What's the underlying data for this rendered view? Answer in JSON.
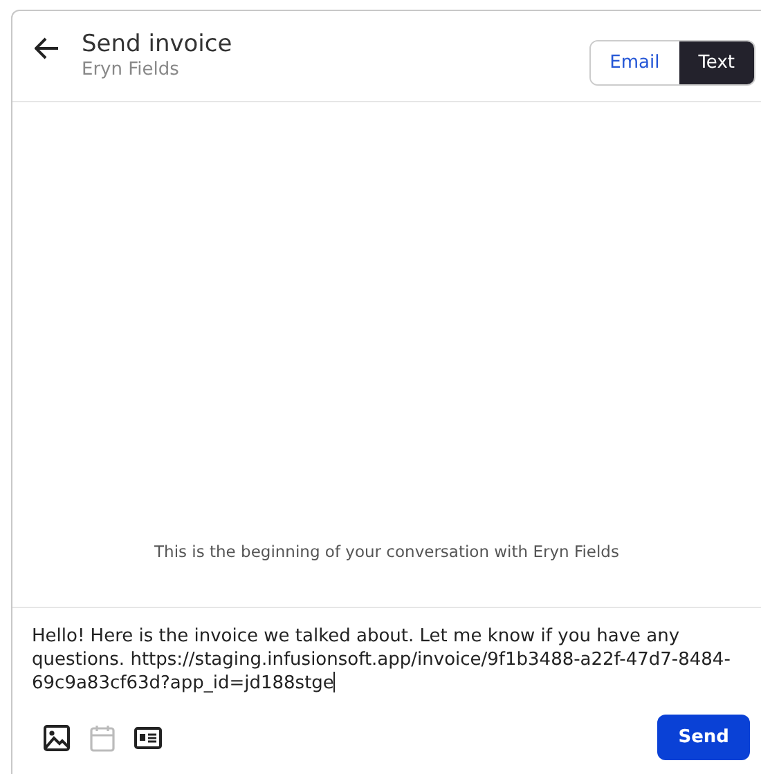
{
  "header": {
    "title": "Send invoice",
    "subtitle": "Eryn Fields"
  },
  "tabs": [
    {
      "label": "Email",
      "selected": false
    },
    {
      "label": "Text",
      "selected": true
    }
  ],
  "conversation": {
    "notice": "This is the beginning of your conversation with Eryn Fields"
  },
  "composer": {
    "value": "Hello! Here is the invoice we talked about. Let me know if you have any questions. https://staging.infusionsoft.app/invoice/9f1b3488-a22f-47d7-8484-69c9a83cf63d?app_id=jd188stge",
    "tools": [
      {
        "kind": "image",
        "disabled": false
      },
      {
        "kind": "calendar",
        "disabled": true
      },
      {
        "kind": "card",
        "disabled": false
      }
    ],
    "send": "Send"
  }
}
